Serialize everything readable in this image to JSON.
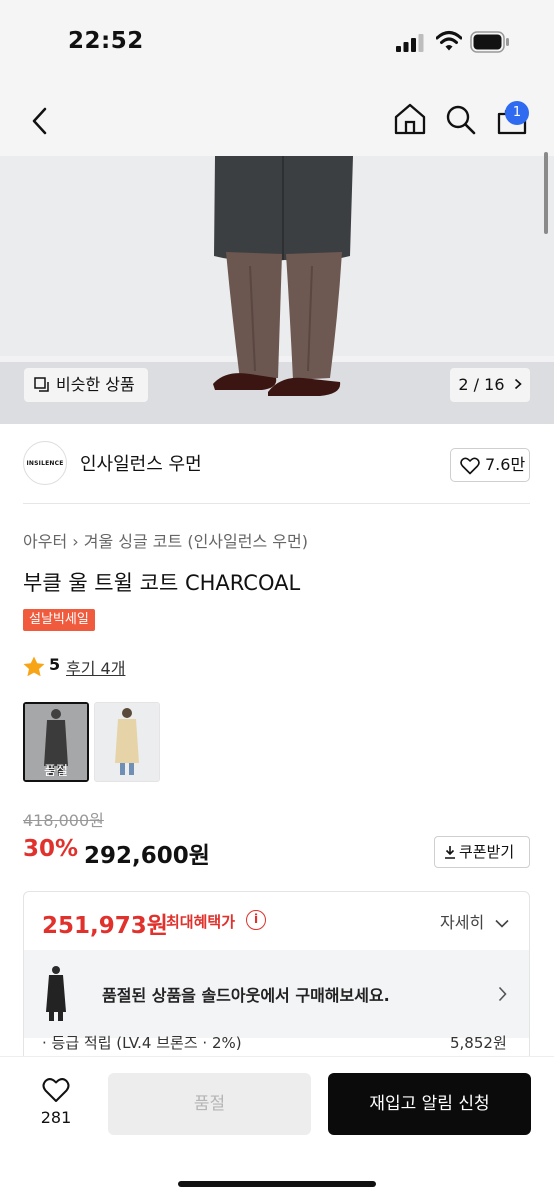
{
  "status": {
    "time": "22:52"
  },
  "nav": {
    "cart_count": "1"
  },
  "hero": {
    "similar_label": "비슷한 상품",
    "page_indicator": "2 / 16"
  },
  "brand": {
    "logo_text": "INSILENCE",
    "name": "인사일런스 우먼",
    "likes": "7.6만"
  },
  "product": {
    "breadcrumb_1": "아우터",
    "breadcrumb_2": "겨울 싱글 코트 (인사일런스 우먼)",
    "title": "부클 울 트윌 코트 CHARCOAL",
    "sale_tag": "설날빅세일",
    "rating": "5",
    "review_label": "후기 4개",
    "soldout_label": "품절",
    "original_price": "418,000원",
    "discount": "30%",
    "price": "292,600원",
    "coupon_label": "쿠폰받기"
  },
  "benefit": {
    "max_price": "251,973원",
    "max_label": "최대혜택가",
    "info_icon": "i",
    "detail_label": "자세히",
    "banner_text": "품절된 상품을 솔드아웃에서 구매해보세요.",
    "grade_label": "· 등급 적립 (LV.4 브론즈 · 2%)",
    "grade_value": "5,852원"
  },
  "bottom": {
    "wish_count": "281",
    "soldout_button": "품절",
    "restock_button": "재입고 알림 신청"
  },
  "colors": {
    "accent_red": "#e0312c",
    "badge_blue": "#2e6bf0",
    "sale_orange": "#f05a3d"
  }
}
